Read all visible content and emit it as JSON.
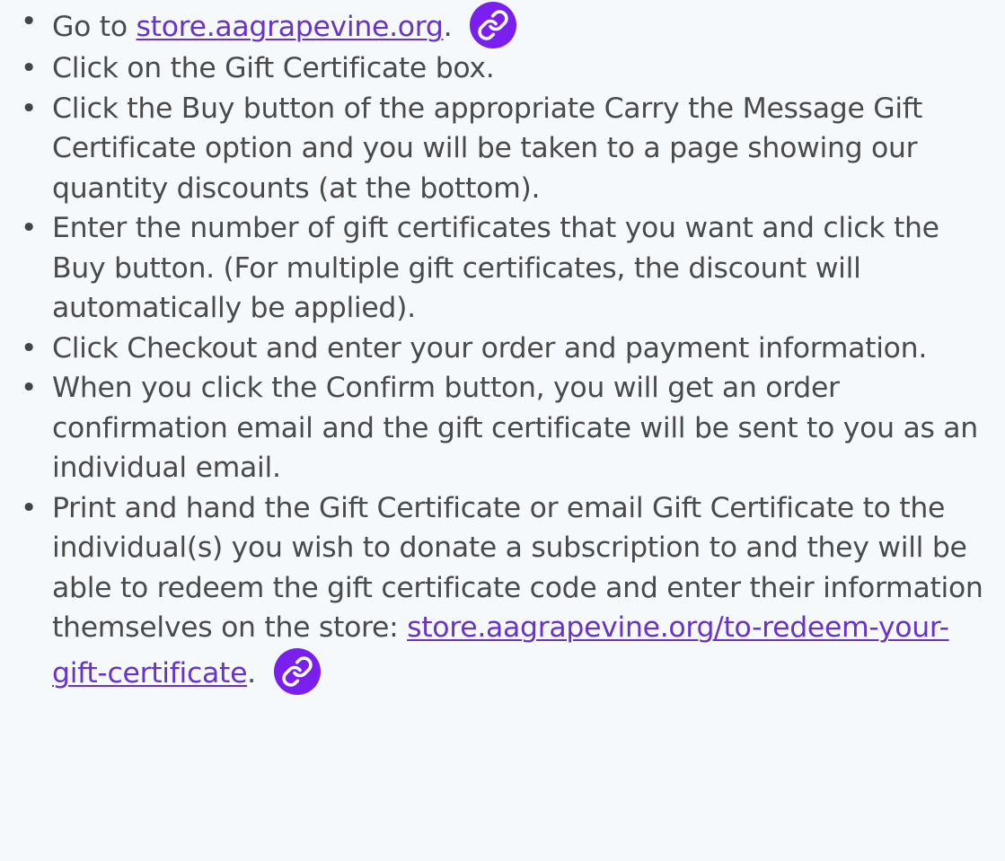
{
  "bullet_char": "•",
  "steps": [
    {
      "before": "Go to ",
      "link_text": "store.aagrapevine.org",
      "after": ".",
      "has_link_badge": true
    },
    {
      "text": "Click on the Gift Certificate box."
    },
    {
      "text": "Click the Buy button of the appropriate Carry the Message Gift Certificate option and you will be taken to a page showing our quantity discounts (at the bottom)."
    },
    {
      "text": "Enter the number of gift certificates that you want and click the Buy button. (For multiple gift certificates, the discount will automatically be applied)."
    },
    {
      "text": "Click Checkout and enter your order and payment information."
    },
    {
      "text": "When you click the Confirm button, you will get an order confirmation email and the gift certificate will be sent to you as an individual email."
    },
    {
      "text": "Print and hand the Gift Certificate or email Gift Certificate to the individual(s) you wish to donate a subscription to and they will be able to redeem the gift certificate code and enter their information themselves on the store: ",
      "link_text": "store.aagrapevine.org/to-redeem-your-gift-certificate",
      "after": ".",
      "has_link_badge": true
    }
  ],
  "colors": {
    "background": "#f6f9fc",
    "text": "#4a4a4a",
    "link": "#6633cc",
    "badge": "#7a1ff0"
  },
  "icons": {
    "link_badge": "chain-link-icon"
  }
}
